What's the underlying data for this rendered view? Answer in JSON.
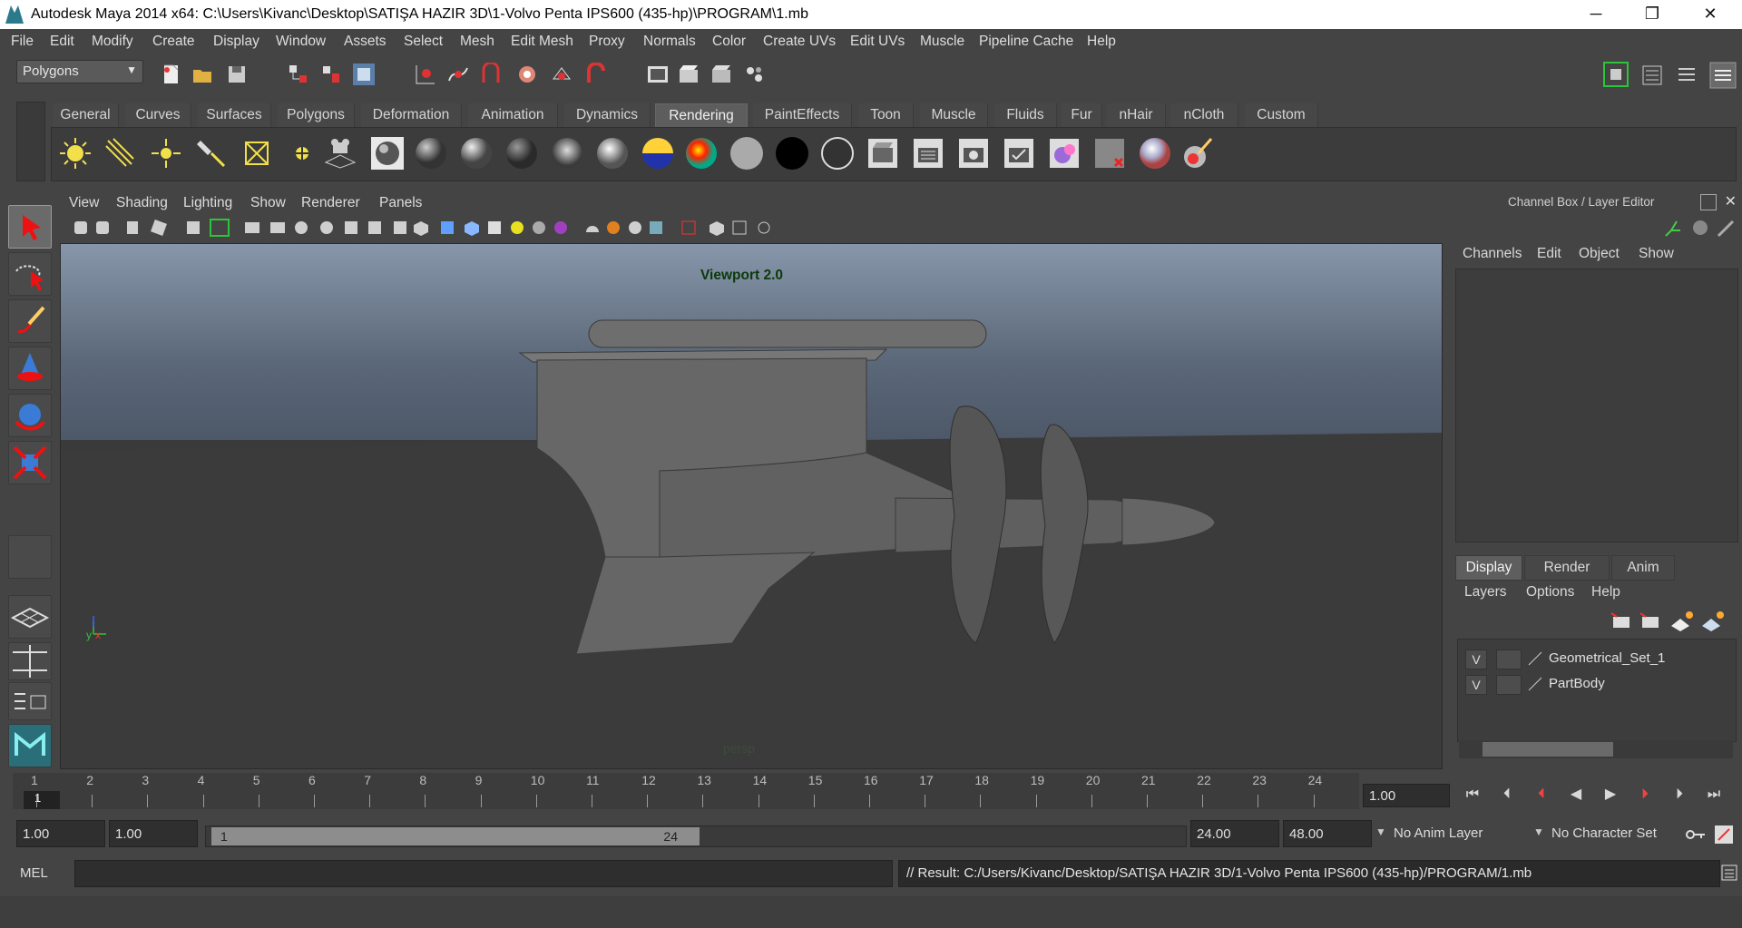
{
  "window": {
    "title": "Autodesk Maya 2014 x64: C:\\Users\\Kivanc\\Desktop\\SATIŞA HAZIR 3D\\1-Volvo Penta IPS600 (435-hp)\\PROGRAM\\1.mb",
    "minimize": "─",
    "restore": "❐",
    "close": "✕"
  },
  "menubar": [
    "File",
    "Edit",
    "Modify",
    "Create",
    "Display",
    "Window",
    "Assets",
    "Select",
    "Mesh",
    "Edit Mesh",
    "Proxy",
    "Normals",
    "Color",
    "Create UVs",
    "Edit UVs",
    "Muscle",
    "Pipeline Cache",
    "Help"
  ],
  "statusline": {
    "mode": "Polygons"
  },
  "shelf": {
    "tabs": [
      "General",
      "Curves",
      "Surfaces",
      "Polygons",
      "Deformation",
      "Animation",
      "Dynamics",
      "Rendering",
      "PaintEffects",
      "Toon",
      "Muscle",
      "Fluids",
      "Fur",
      "nHair",
      "nCloth",
      "Custom"
    ],
    "active_tab": "Rendering"
  },
  "viewport": {
    "menu": [
      "View",
      "Shading",
      "Lighting",
      "Show",
      "Renderer",
      "Panels"
    ],
    "renderer_label": "Viewport 2.0",
    "camera_label": "persp",
    "axis": {
      "x": "x",
      "y": "y"
    }
  },
  "channelbox": {
    "title": "Channel Box / Layer Editor",
    "menu": [
      "Channels",
      "Edit",
      "Object",
      "Show"
    ]
  },
  "layereditor": {
    "tabs": [
      "Display",
      "Render",
      "Anim"
    ],
    "active_tab": "Display",
    "menu": [
      "Layers",
      "Options",
      "Help"
    ],
    "layers": [
      {
        "visible": "V",
        "name": "Geometrical_Set_1"
      },
      {
        "visible": "V",
        "name": "PartBody"
      }
    ]
  },
  "timeslider": {
    "ticks": [
      "1",
      "2",
      "3",
      "4",
      "5",
      "6",
      "7",
      "8",
      "9",
      "10",
      "11",
      "12",
      "13",
      "14",
      "15",
      "16",
      "17",
      "18",
      "19",
      "20",
      "21",
      "22",
      "23",
      "24"
    ],
    "current_frame_marker": "1",
    "current_time": "1.00"
  },
  "range": {
    "start_time": "1.00",
    "playback_start": "1.00",
    "range_start_label": "1",
    "range_end_label": "24",
    "playback_end": "24.00",
    "end_time": "48.00",
    "anim_layer": "No Anim Layer",
    "character_set": "No Character Set"
  },
  "commandline": {
    "language": "MEL",
    "input": "",
    "result": "// Result: C:/Users/Kivanc/Desktop/SATIŞA HAZIR 3D/1-Volvo Penta IPS600 (435-hp)/PROGRAM/1.mb"
  },
  "colors": {
    "ui_bg": "#444444",
    "sky": "#8796aa",
    "ground": "#3b3b3b",
    "active_tab": "#5e5e5e"
  }
}
